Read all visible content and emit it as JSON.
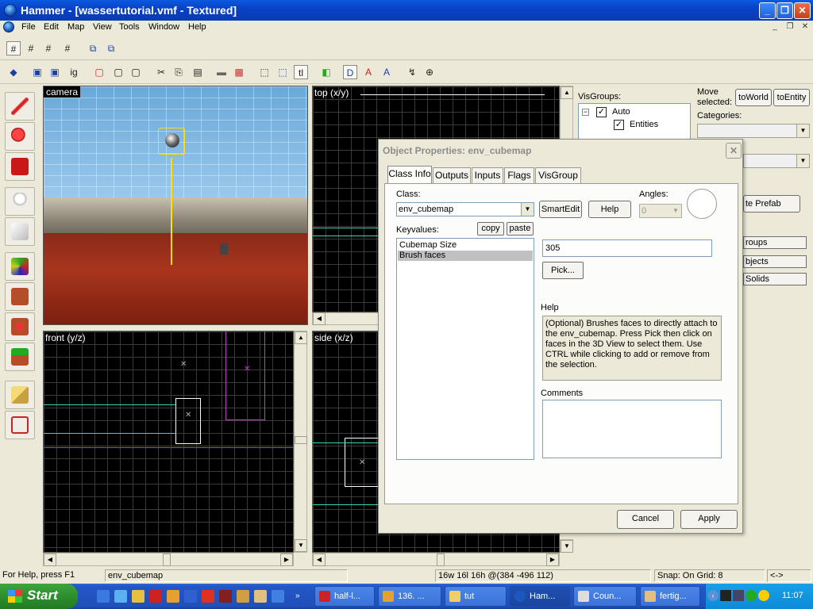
{
  "window": {
    "title": "Hammer - [wassertutorial.vmf - Textured]"
  },
  "menu": {
    "items": [
      "File",
      "Edit",
      "Map",
      "View",
      "Tools",
      "Window",
      "Help"
    ]
  },
  "views": {
    "camera": "camera",
    "top": "top (x/y)",
    "front": "front (y/z)",
    "side": "side (x/z)"
  },
  "right_panel": {
    "visgroups_label": "VisGroups:",
    "tree": [
      {
        "label": "Auto",
        "checked": true
      },
      {
        "label": "Entities",
        "checked": true
      }
    ],
    "move_selected": "Move selected:",
    "to_world": "toWorld",
    "to_entity": "toEntity",
    "categories_label": "Categories:",
    "create_prefab": "te Prefab",
    "groups": "roups",
    "objects": "bjects",
    "solids": "Solids"
  },
  "dialog": {
    "title": "Object Properties: env_cubemap",
    "close": "✕",
    "tabs": [
      "Class Info",
      "Outputs",
      "Inputs",
      "Flags",
      "VisGroup"
    ],
    "class_label": "Class:",
    "class_value": "env_cubemap",
    "smartedit": "SmartEdit",
    "help_button": "Help",
    "angles_label": "Angles:",
    "angles_value": "0",
    "keyvalues_label": "Keyvalues:",
    "copy": "copy",
    "paste": "paste",
    "keyvalues": [
      "Cubemap Size",
      "Brush faces"
    ],
    "value": "305",
    "pick": "Pick...",
    "help_label": "Help",
    "help_text": "(Optional) Brushes faces to directly attach to the env_cubemap. Press Pick then click on faces in the 3D View to select them. Use CTRL while clicking to add or remove from the selection.",
    "comments_label": "Comments",
    "cancel": "Cancel",
    "apply": "Apply"
  },
  "statusbar": {
    "help": "For Help, press F1",
    "selection": "env_cubemap",
    "size": "16w 16l 16h @(384 -496 112)",
    "snap": "Snap: On Grid: 8",
    "arrows": "<->"
  },
  "taskbar": {
    "start": "Start",
    "tasks": [
      "half-l...",
      "136. ...",
      "tut",
      "Ham...",
      "Coun...",
      "fertig..."
    ],
    "clock": "11:07"
  },
  "colors": {
    "xp_blue": "#0a5ae0",
    "start_green": "#2d8f2d",
    "grid_line": "#3a3a3a",
    "selection": "#c0c0c0"
  }
}
